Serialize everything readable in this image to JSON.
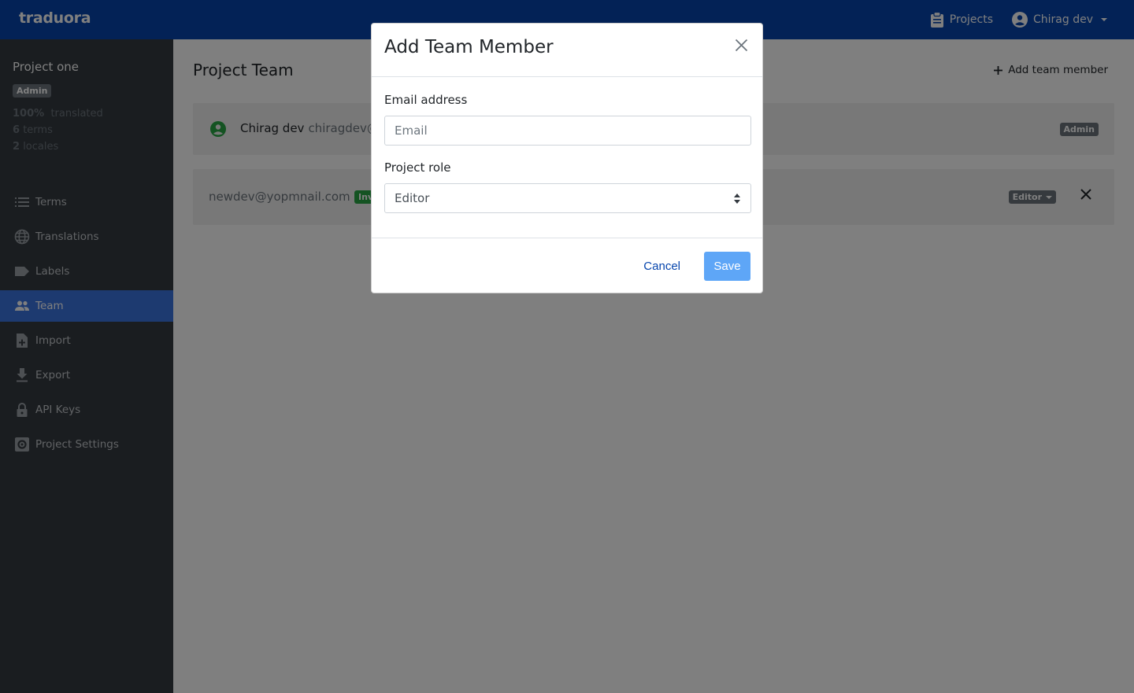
{
  "brand": "traduora",
  "topnav": {
    "projects_label": "Projects",
    "user_label": "Chirag dev"
  },
  "sidebar": {
    "project_name": "Project one",
    "role_badge": "Admin",
    "stats": {
      "translated_pct": "100%",
      "translated_label": "translated",
      "terms": "6 terms",
      "terms_count": "6",
      "terms_label": "terms",
      "locales_count": "2",
      "locales_label": "locales"
    },
    "items": [
      {
        "label": "Terms",
        "icon": "list-icon"
      },
      {
        "label": "Translations",
        "icon": "globe-icon"
      },
      {
        "label": "Labels",
        "icon": "label-icon"
      },
      {
        "label": "Team",
        "icon": "team-icon",
        "active": true
      },
      {
        "label": "Import",
        "icon": "file-plus-icon"
      },
      {
        "label": "Export",
        "icon": "download-icon"
      },
      {
        "label": "API Keys",
        "icon": "lock-icon"
      },
      {
        "label": "Project Settings",
        "icon": "settings-icon"
      }
    ]
  },
  "main": {
    "title": "Project Team",
    "add_member_label": "Add team member",
    "members": [
      {
        "name": "Chirag dev",
        "email": "chiragdev@",
        "role": "Admin"
      }
    ],
    "invites": [
      {
        "email": "newdev@yopmnail.com",
        "status": "Inv",
        "role": "Editor"
      }
    ]
  },
  "modal": {
    "title": "Add Team Member",
    "email_label": "Email address",
    "email_placeholder": "Email",
    "email_value": "",
    "role_label": "Project role",
    "role_value": "Editor",
    "cancel_label": "Cancel",
    "save_label": "Save"
  },
  "colors": {
    "brand": "#0645ad",
    "sidebar_bg": "#343a40",
    "active_nav": "#3b74e0",
    "save_button": "#4d9df7",
    "success": "#28a745"
  }
}
